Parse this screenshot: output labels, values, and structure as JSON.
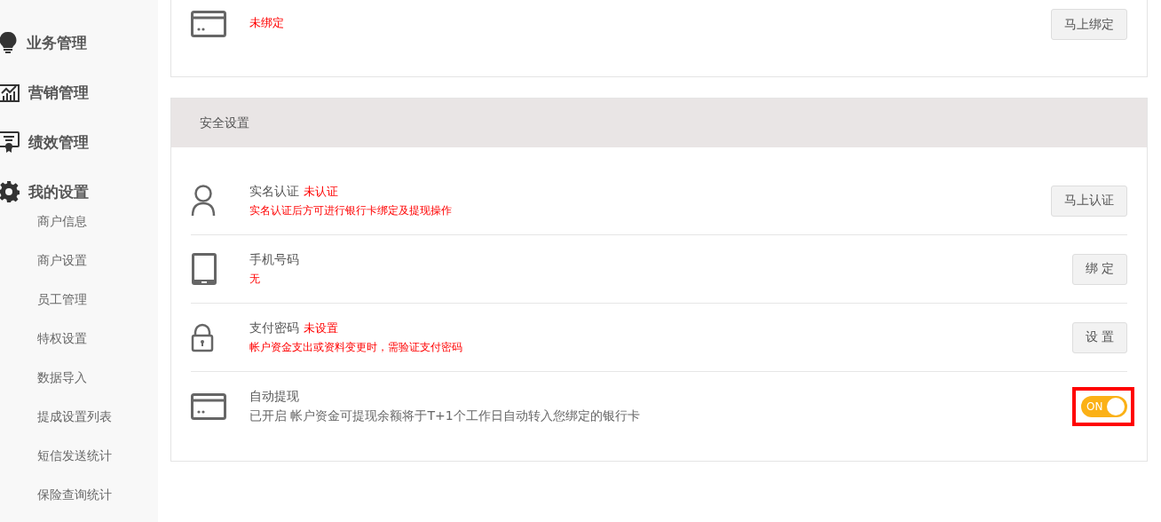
{
  "sidebar": {
    "items": [
      {
        "label": "业务管理"
      },
      {
        "label": "营销管理"
      },
      {
        "label": "绩效管理"
      },
      {
        "label": "我的设置",
        "children": [
          {
            "label": "商户信息"
          },
          {
            "label": "商户设置"
          },
          {
            "label": "员工管理"
          },
          {
            "label": "特权设置"
          },
          {
            "label": "数据导入"
          },
          {
            "label": "提成设置列表"
          },
          {
            "label": "短信发送统计"
          },
          {
            "label": "保险查询统计"
          }
        ]
      }
    ]
  },
  "bank_card": {
    "status": "未绑定",
    "button": "马上绑定"
  },
  "security": {
    "title": "安全设置",
    "rows": [
      {
        "kind": "button",
        "title": "实名认证",
        "status": "未认证",
        "description": "实名认证后方可进行银行卡绑定及提现操作",
        "alert": true,
        "button": "马上认证"
      },
      {
        "kind": "button",
        "title": "手机号码",
        "description": "无",
        "alert": true,
        "button": "绑 定"
      },
      {
        "kind": "button",
        "title": "支付密码",
        "status": "未设置",
        "description": "帐户资金支出或资料变更时，需验证支付密码",
        "alert": true,
        "button": "设 置"
      },
      {
        "kind": "toggle",
        "title": "自动提现",
        "description": "已开启 帐户资金可提现余额将于T+1个工作日自动转入您绑定的银行卡",
        "alert": false,
        "toggle": {
          "label": "ON",
          "on": true,
          "highlighted": true
        }
      }
    ]
  }
}
